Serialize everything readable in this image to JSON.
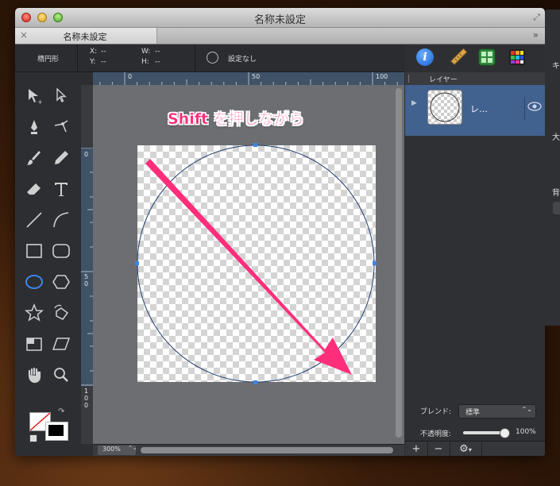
{
  "window": {
    "title": "名称未設定"
  },
  "tab": {
    "label": "名称未設定",
    "close": "×",
    "overflow": "»"
  },
  "infobar": {
    "tool_name": "楕円形",
    "x_label": "X:",
    "x_value": "--",
    "y_label": "Y:",
    "y_value": "--",
    "w_label": "W:",
    "w_value": "--",
    "h_label": "H:",
    "h_value": "--",
    "shape_setting": "設定なし"
  },
  "ruler": {
    "h_ticks": [
      "0",
      "50",
      "100"
    ],
    "v_ticks": [
      "0",
      "5\n0",
      "1\n0\n0"
    ]
  },
  "canvas": {
    "annotation": "Shift を押しながら"
  },
  "zoom": {
    "value": "300%",
    "stepper": "⌃⌄"
  },
  "layers": {
    "header": "レイヤー",
    "items": [
      {
        "name": "レ…"
      }
    ],
    "blend_label": "ブレンド:",
    "blend_value": "標準",
    "opacity_label": "不透明度:",
    "opacity_value": "100%",
    "opacity_fraction": 1.0
  },
  "layer_footer": {
    "add": "+",
    "remove": "−",
    "settings": "⚙"
  },
  "win2": {
    "peek_1": "キ",
    "peek_2": "大",
    "peek_3": "背"
  },
  "colors": {
    "accent_pink": "#ff2e7a",
    "selection_blue": "#3b86e8",
    "layer_row": "#41618f"
  }
}
